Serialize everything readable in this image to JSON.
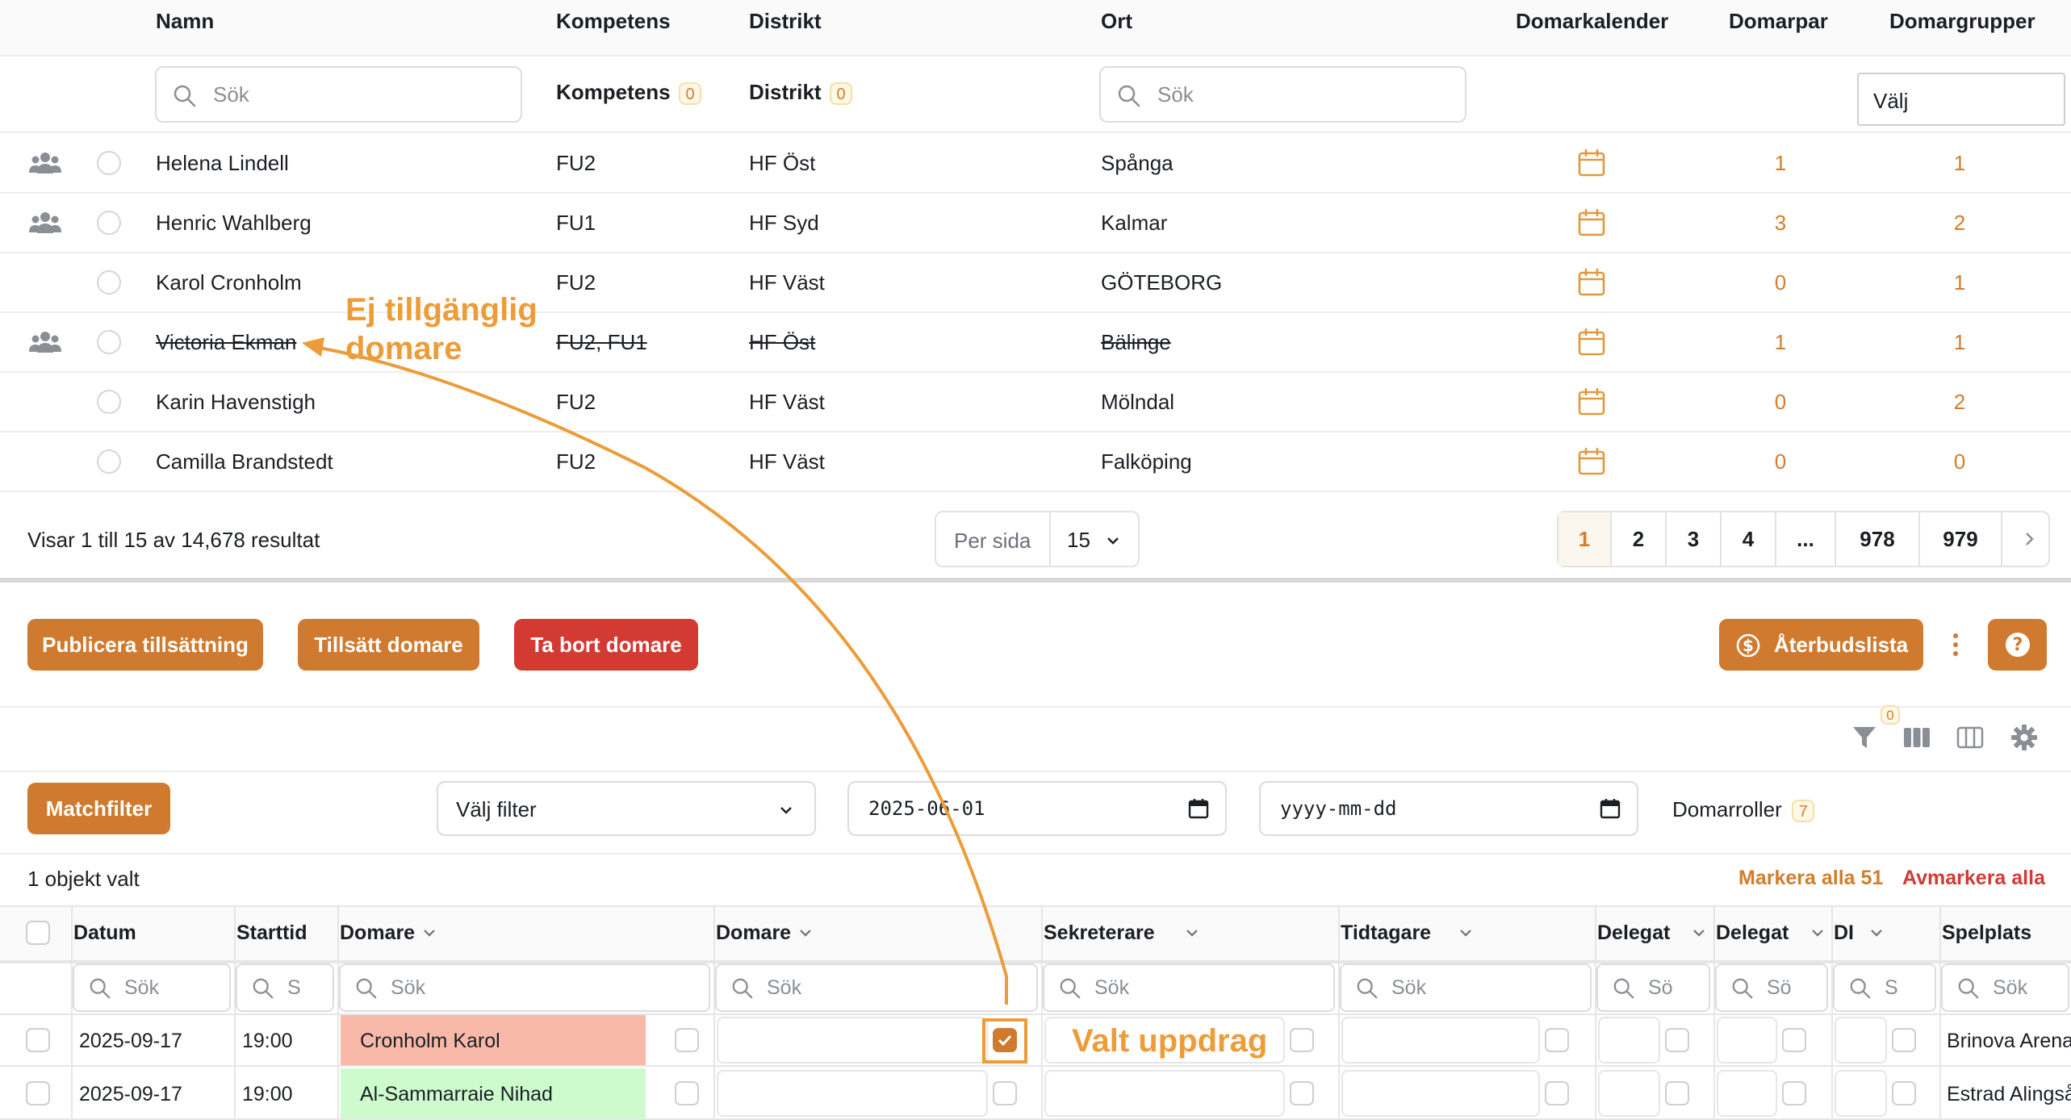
{
  "top_table": {
    "headers": {
      "name": "Namn",
      "competence": "Kompetens",
      "district": "Distrikt",
      "city": "Ort",
      "calendar": "Domarkalender",
      "pairs": "Domarpar",
      "groups": "Domargrupper"
    },
    "filters": {
      "name_placeholder": "Sök",
      "competence_label": "Kompetens",
      "competence_count": "0",
      "district_label": "Distrikt",
      "district_count": "0",
      "city_placeholder": "Sök",
      "groups_select": "Välj"
    },
    "rows": [
      {
        "name": "Helena Lindell",
        "competence": "FU2",
        "district": "HF Öst",
        "city": "Spånga",
        "pairs": "1",
        "groups": "1"
      },
      {
        "name": "Henric Wahlberg",
        "competence": "FU1",
        "district": "HF Syd",
        "city": "Kalmar",
        "pairs": "3",
        "groups": "2"
      },
      {
        "name": "Karol Cronholm",
        "competence": "FU2",
        "district": "HF Väst",
        "city": "GÖTEBORG",
        "pairs": "0",
        "groups": "1"
      },
      {
        "name": "Victoria Ekman",
        "competence": "FU2, FU1",
        "district": "HF Öst",
        "city": "Bälinge",
        "pairs": "1",
        "groups": "1"
      },
      {
        "name": "Karin Havenstigh",
        "competence": "FU2",
        "district": "HF Väst",
        "city": "Mölndal",
        "pairs": "0",
        "groups": "2"
      },
      {
        "name": "Camilla Brandstedt",
        "competence": "FU2",
        "district": "HF Väst",
        "city": "Falköping",
        "pairs": "0",
        "groups": "0"
      }
    ],
    "footer": {
      "summary": "Visar 1 till 15 av 14,678 resultat",
      "per_page_label": "Per sida",
      "per_page_value": "15",
      "pages": [
        "1",
        "2",
        "3",
        "4",
        "...",
        "978",
        "979"
      ]
    }
  },
  "toolbar": {
    "publish": "Publicera tillsättning",
    "assign": "Tillsätt domare",
    "remove": "Ta bort domare",
    "cancellations": "Återbudslista",
    "filter_count": "0"
  },
  "filters_bar": {
    "match_filter": "Matchfilter",
    "choose_filter": "Välj filter",
    "date_from": "2025-06-01",
    "date_to": "yyyy-mm-dd",
    "roles_label": "Domarroller",
    "roles_count": "7"
  },
  "selection": {
    "status": "1 objekt valt",
    "select_all": "Markera alla 51",
    "deselect_all": "Avmarkera alla"
  },
  "match_table": {
    "headers": [
      "Datum",
      "Starttid",
      "Domare",
      "Domare",
      "Sekreterare",
      "Tidtagare",
      "Delegat",
      "Delegat",
      "DI",
      "Spelplats"
    ],
    "search_placeholders": [
      "Sök",
      "S",
      "Sök",
      "Sök",
      "Sök",
      "Sök",
      "Sö",
      "Sö",
      "S",
      "Sök"
    ],
    "rows": [
      {
        "date": "2025-09-17",
        "time": "19:00",
        "referee1": "Cronholm Karol",
        "venue": "Brinova Arena"
      },
      {
        "date": "2025-09-17",
        "time": "19:00",
        "referee1": "Al-Sammarraie Nihad",
        "venue": "Estrad Alingsås"
      }
    ]
  },
  "annotations": {
    "unavailable": "Ej tillgänglig domare",
    "selected": "Valt uppdrag"
  },
  "colors": {
    "accent": "#cf7a2e",
    "danger": "#d33a32",
    "annotation": "#ec9c38",
    "unavailable_cell": "#f8b9a9",
    "available_cell": "#cdfbcd"
  }
}
